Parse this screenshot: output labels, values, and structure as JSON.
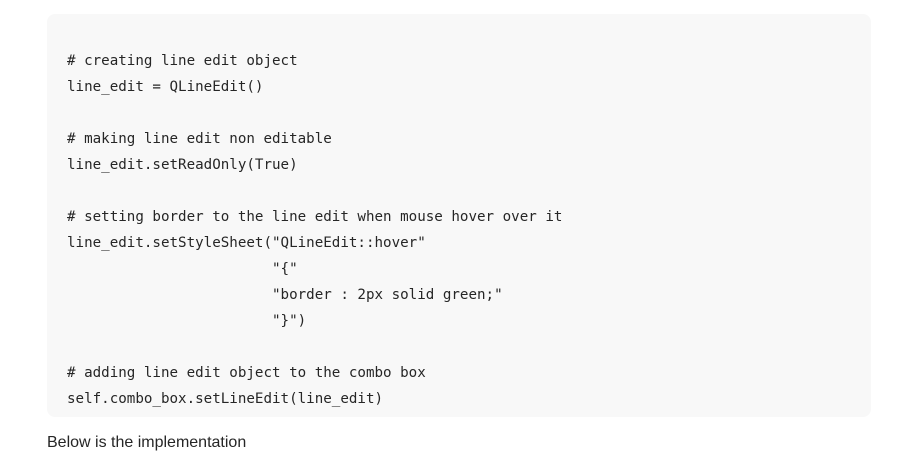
{
  "code": {
    "lines": [
      "# creating line edit object",
      "line_edit = QLineEdit()",
      "",
      "# making line edit non editable",
      "line_edit.setReadOnly(True)",
      "",
      "# setting border to the line edit when mouse hover over it",
      "line_edit.setStyleSheet(\"QLineEdit::hover\"",
      "                        \"{\"",
      "                        \"border : 2px solid green;\"",
      "                        \"}\")",
      "",
      "# adding line edit object to the combo box",
      "self.combo_box.setLineEdit(line_edit)"
    ]
  },
  "caption": "Below is the implementation"
}
